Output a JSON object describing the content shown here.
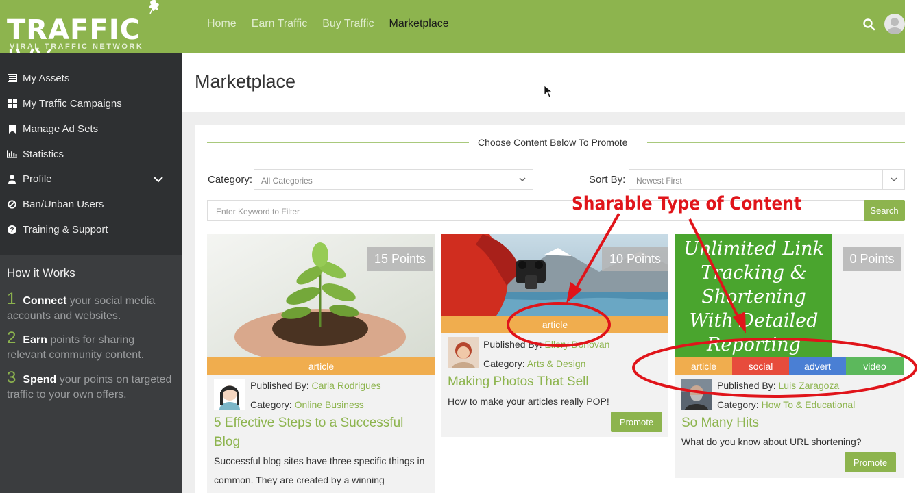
{
  "brand": {
    "logo_bold": "TRAFFIC",
    "logo_light": "IVY",
    "tagline": "VIRAL TRAFFIC NETWORK"
  },
  "nav": {
    "home": "Home",
    "earn": "Earn Traffic",
    "buy": "Buy Traffic",
    "marketplace": "Marketplace"
  },
  "sidebar": {
    "items": [
      {
        "label": "My Assets"
      },
      {
        "label": "My Traffic Campaigns"
      },
      {
        "label": "Manage Ad Sets"
      },
      {
        "label": "Statistics"
      },
      {
        "label": "Profile"
      },
      {
        "label": "Ban/Unban Users"
      },
      {
        "label": "Training & Support"
      }
    ],
    "how_title": "How it Works",
    "steps": [
      {
        "num": "1",
        "bold": "Connect",
        "text": " your social media accounts and websites."
      },
      {
        "num": "2",
        "bold": "Earn",
        "text": " points for sharing relevant community content."
      },
      {
        "num": "3",
        "bold": "Spend",
        "text": " your points on targeted traffic to your own offers."
      }
    ]
  },
  "page": {
    "title": "Marketplace",
    "choose": "Choose Content Below To Promote",
    "category_label": "Category:",
    "category_value": "All Categories",
    "sort_label": "Sort By:",
    "sort_value": "Newest First",
    "keyword_placeholder": "Enter Keyword to Filter",
    "search_button": "Search"
  },
  "cards": [
    {
      "points": "15 Points",
      "tags": [
        "article"
      ],
      "published_label": "Published By:",
      "author": "Carla Rodrigues",
      "category_label": "Category:",
      "category": "Online Business",
      "title": "5 Effective Steps to a Successful Blog",
      "desc": "Successful blog sites have three specific things in common. They are created by a winning"
    },
    {
      "points": "10 Points",
      "tags": [
        "article"
      ],
      "published_label": "Published By:",
      "author": "Ellory Donovan",
      "category_label": "Category:",
      "category": "Arts & Design",
      "title": "Making Photos That Sell",
      "desc": "How to make your articles really POP!",
      "promote": "Promote"
    },
    {
      "points": "0 Points",
      "image_text": [
        "Unlimited Link",
        "Tracking &",
        "Shortening",
        "With Detailed",
        "Reporting"
      ],
      "tags": [
        "article",
        "social",
        "advert",
        "video"
      ],
      "published_label": "Published By:",
      "author": "Luis Zaragoza",
      "category_label": "Category:",
      "category": "How To & Educational",
      "title": "So Many Hits",
      "desc": "What do you know about URL shortening?",
      "promote": "Promote"
    }
  ],
  "annotation": {
    "label": "Sharable Type of Content"
  },
  "colors": {
    "brand_green": "#8db44e",
    "tag_orange": "#f0ad4e",
    "tag_red": "#e74c3c",
    "tag_blue": "#4a7fd4",
    "tag_green": "#5cb85c",
    "annotation_red": "#e0141a"
  }
}
